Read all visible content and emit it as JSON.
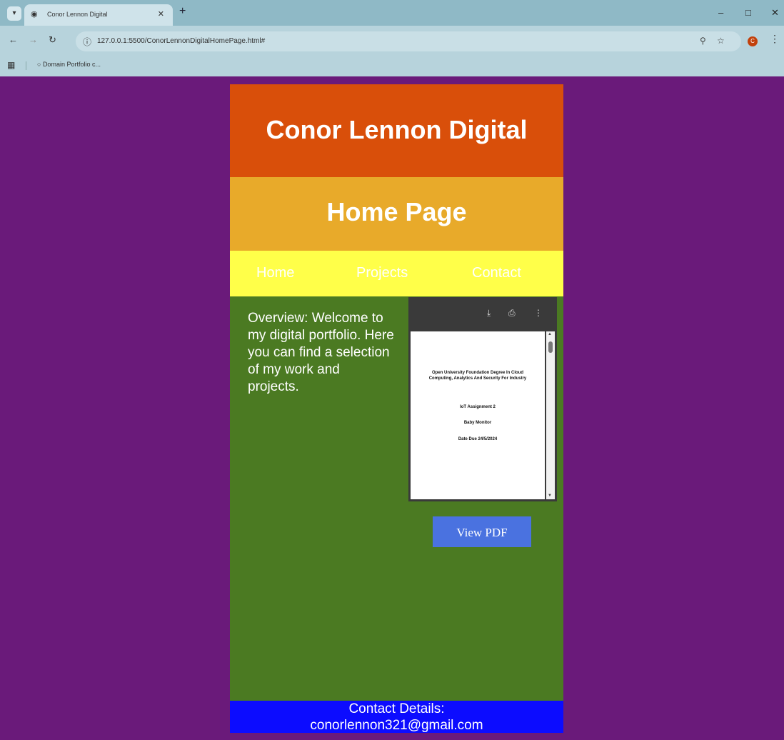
{
  "browser": {
    "tab_title": "Conor Lennon Digital",
    "url": "127.0.0.1:5500/ConorLennonDigitalHomePage.html#",
    "bookmark": "Domain Portfolio c...",
    "profile_initial": "C"
  },
  "site": {
    "title": "Conor Lennon Digital",
    "page_heading": "Home Page",
    "nav": [
      "Home",
      "Projects",
      "Contact"
    ],
    "overview": "Overview: Welcome to my digital portfolio. Here you can find a selection of my work and projects.",
    "view_pdf_label": "View PDF",
    "contact_label": "Contact Details:",
    "contact_email": "conorlennon321@gmail.com",
    "colors": {
      "background": "#6a1a7a",
      "header": "#d94f0a",
      "subheader": "#e8aa2a",
      "nav": "#ffff49",
      "content": "#4b7a22",
      "footer": "#0c0cff",
      "button": "#4a72e0"
    }
  },
  "pdf": {
    "line1": "Open University Foundation Degree In Cloud Computing, Analytics And Security For Industry",
    "line2": "IoT Assignment 2",
    "line3": "Baby Monitor",
    "line4": "Date Due 24/5/2024"
  }
}
